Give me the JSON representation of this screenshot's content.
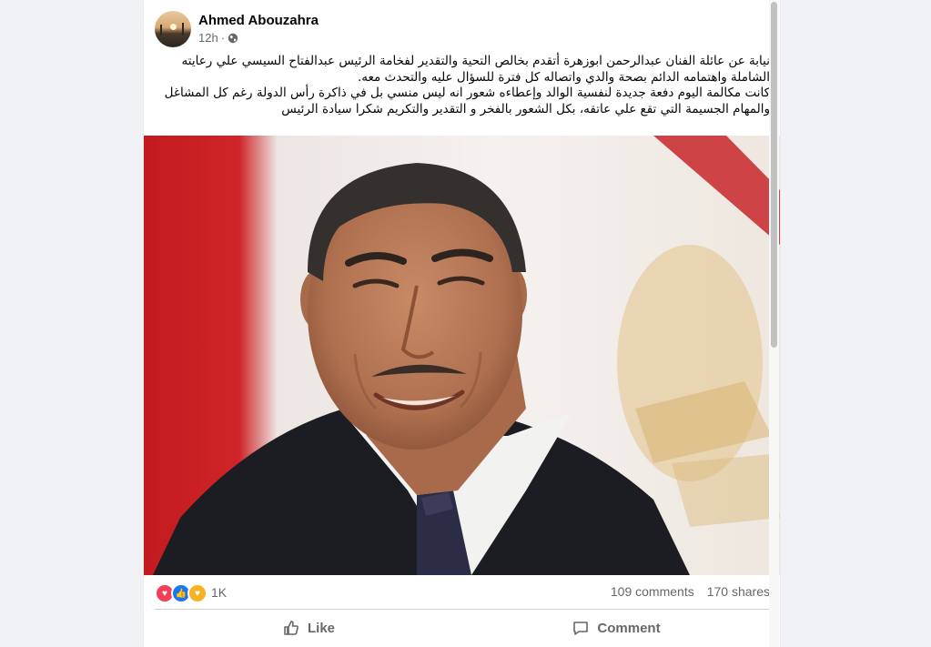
{
  "post": {
    "author": "Ahmed Abouzahra",
    "time": "12h",
    "separator": "·",
    "privacy_icon": "globe-icon",
    "paragraph_1": "نيابة عن عائلة الفنان عبدالرحمن ابوزهرة أتقدم بخالص التحية والتقدير لفخامة الرئيس عبدالفتاح السيسي علي رعايته الشاملة واهتمامه الدائم بصحة والدي  واتصاله كل فترة للسؤال عليه والتحدث معه.",
    "paragraph_2": "كانت مكالمة اليوم دفعة جديدة لنفسية الوالد وإعطاءه شعور انه ليس منسي بل في ذاكرة رأس الدولة رغم كل المشاغل والمهام الجسيمة التي تقع علي عاتقه، بكل الشعور بالفخر و التقدير والتكريم شكرا سيادة الرئيس"
  },
  "stats": {
    "reactions": [
      "love-icon",
      "like-icon",
      "care-icon"
    ],
    "reaction_count": "1K",
    "comments": "109 comments",
    "shares": "170 shares"
  },
  "actions": {
    "like": "Like",
    "comment": "Comment"
  },
  "colors": {
    "accent": "#1877f2",
    "love": "#f33e58",
    "care": "#f7b125",
    "secondary_text": "#65676b"
  }
}
